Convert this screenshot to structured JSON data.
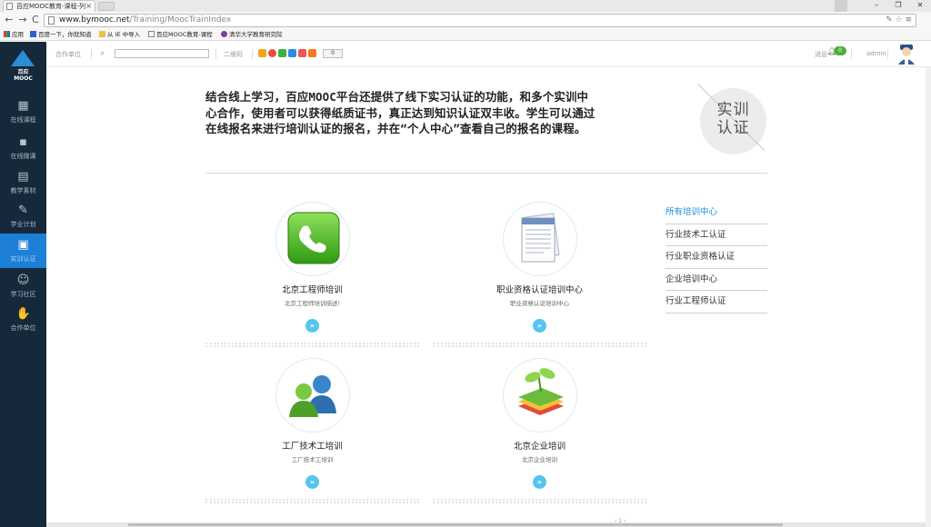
{
  "browser": {
    "tab_title": "百应MOOC教育-课程-列",
    "tab_close": "×",
    "url_host": "www.bymooc.net",
    "url_path": "/Training/MoocTrainIndex",
    "omni_right": "✎ ☆ ≡",
    "back": "←",
    "forward": "→",
    "reload": "C",
    "win_min": "–",
    "win_max": "❐",
    "win_close": "✕",
    "bookmarks": [
      "应用",
      "百度一下，你就知道",
      "从 IE 中导入",
      "百应MOOC教育-课程",
      "清华大学教育研究院"
    ]
  },
  "sidebar": {
    "logo_line1": "百应",
    "logo_line2": "MOOC",
    "items": [
      {
        "label": "在线课程",
        "icon": "grid-icon",
        "glyph": "▦"
      },
      {
        "label": "在线微课",
        "icon": "small-grid-icon",
        "glyph": "▪"
      },
      {
        "label": "教学素材",
        "icon": "files-icon",
        "glyph": "▤"
      },
      {
        "label": "学业计划",
        "icon": "pencil-icon",
        "glyph": "✎"
      },
      {
        "label": "实训认证",
        "icon": "certificate-icon",
        "glyph": "▣"
      },
      {
        "label": "学习社区",
        "icon": "people-icon",
        "glyph": "☺"
      },
      {
        "label": "合作单位",
        "icon": "handshake-icon",
        "glyph": "✋"
      }
    ],
    "active_index": 4
  },
  "header": {
    "partner": "合作单位",
    "search_icon": "⌕",
    "qrcode": "二维码",
    "share_count": "0",
    "messages": "消息",
    "messages_count": "0",
    "user": "admin"
  },
  "intro": {
    "text": "结合线上学习，百应MOOC平台还提供了线下实习认证的功能，和多个实训中心合作，使用者可以获得纸质证书，真正达到知识认证双丰收。学生可以通过在线报名来进行培训认证的报名，并在“个人中心”查看自己的报名的课程。",
    "badge": "实训认证"
  },
  "cards": [
    {
      "title": "北京工程师培训",
      "desc": "北京工程师培训描述!",
      "icon": "phone-icon",
      "arrow": "»"
    },
    {
      "title": "职业资格认证培训中心",
      "desc": "职业资格认证培训中心",
      "icon": "document-icon",
      "arrow": "»"
    },
    {
      "title": "工厂技术工培训",
      "desc": "工厂技术工培训",
      "icon": "users-icon",
      "arrow": "»"
    },
    {
      "title": "北京企业培训",
      "desc": "北京企业培训",
      "icon": "plant-books-icon",
      "arrow": "»"
    }
  ],
  "right_nav": [
    {
      "label": "所有培训中心",
      "active": true
    },
    {
      "label": "行业技术工认证",
      "active": false
    },
    {
      "label": "行业职业资格认证",
      "active": false
    },
    {
      "label": "企业培训中心",
      "active": false
    },
    {
      "label": "行业工程师认证",
      "active": false
    }
  ],
  "pager": "‹  1  ›"
}
